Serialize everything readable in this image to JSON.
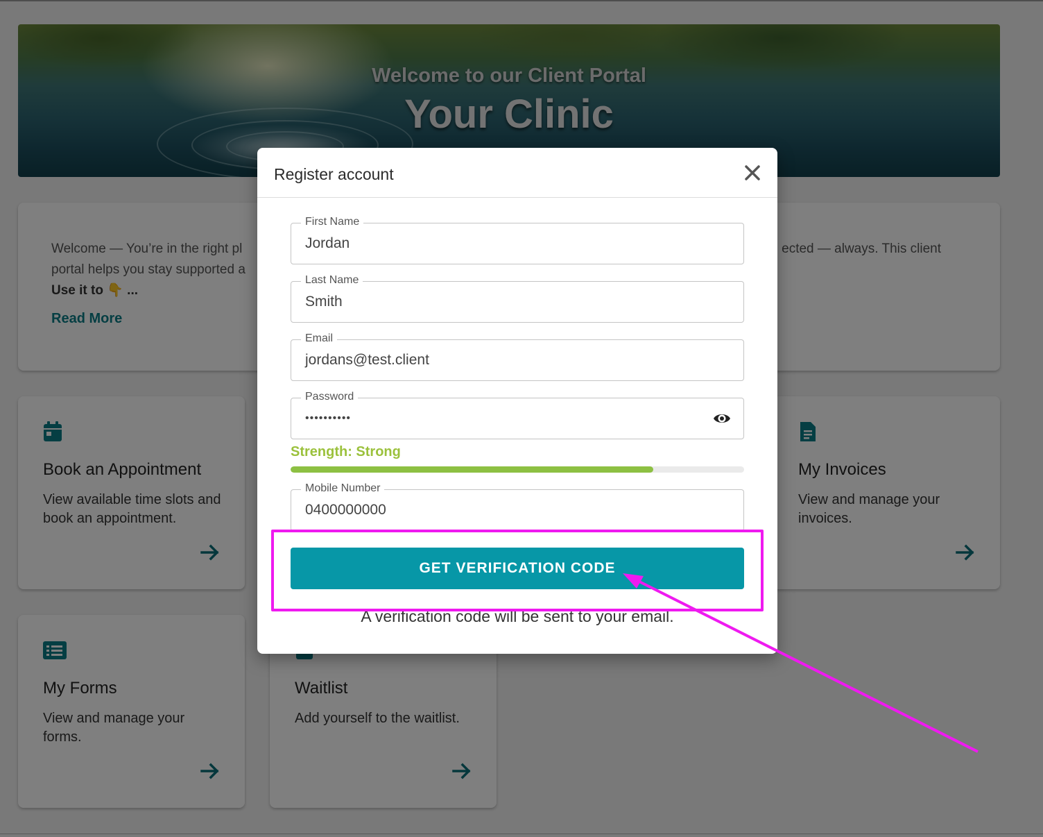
{
  "hero": {
    "subtitle": "Welcome to our Client Portal",
    "title": "Your Clinic"
  },
  "welcome": {
    "text_left": "Welcome — You’re in the right pl",
    "text_left_line2": "portal helps you stay supported a",
    "text_right": "ected — always. This client",
    "use_it": "Use it to 👇 ...",
    "read_more": "Read More"
  },
  "tiles": [
    {
      "title": "Book an Appointment",
      "desc": "View available time slots and book an appointment.",
      "icon": "calendar-icon"
    },
    {
      "title": "",
      "desc": "",
      "icon": ""
    },
    {
      "title": "",
      "desc": "",
      "icon": ""
    },
    {
      "title": "My Invoices",
      "desc": "View and manage your invoices.",
      "icon": "invoice-icon"
    },
    {
      "title": "My Forms",
      "desc": "View and manage your forms.",
      "icon": "list-icon"
    },
    {
      "title": "Waitlist",
      "desc": "Add yourself to the waitlist.",
      "icon": "waitlist-icon"
    }
  ],
  "modal": {
    "title": "Register account",
    "close_icon": "close-icon",
    "fields": {
      "first_name": {
        "label": "First Name",
        "value": "Jordan"
      },
      "last_name": {
        "label": "Last Name",
        "value": "Smith"
      },
      "email": {
        "label": "Email",
        "value": "jordans@test.client"
      },
      "password": {
        "label": "Password",
        "value": "••••••••••"
      },
      "mobile": {
        "label": "Mobile Number",
        "value": "0400000000"
      }
    },
    "strength_text": "Strength: Strong",
    "strength_fraction": 0.8,
    "button_label": "GET VERIFICATION CODE",
    "note": "A verification code will be sent to your email."
  },
  "colors": {
    "accent": "#0797a7",
    "teal_text": "#0a7d86",
    "strength": "#8dc043",
    "annotation": "#ef1af0"
  }
}
